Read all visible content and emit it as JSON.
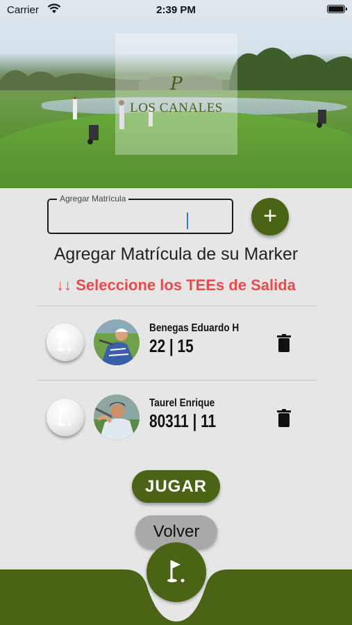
{
  "status_bar": {
    "carrier": "Carrier",
    "time": "2:39 PM"
  },
  "hero": {
    "club_monogram": "P",
    "club_name": "LOS CANALES"
  },
  "matricula_input": {
    "label": "Agregar Matrícula",
    "value": ""
  },
  "add_button": {
    "icon": "plus-icon"
  },
  "marker_title": "Agregar Matrícula de su Marker",
  "tees_warning": "↓↓ Seleccione los TEEs de Salida",
  "players": [
    {
      "name": "Benegas Eduardo H",
      "stats": "22 | 15",
      "tee_icon": "golf-flag-icon",
      "delete_icon": "trash-icon"
    },
    {
      "name": "Taurel Enrique",
      "stats": "80311 | 11",
      "tee_icon": "golf-flag-icon",
      "delete_icon": "trash-icon"
    }
  ],
  "jugar_button": "JUGAR",
  "volver_button": "Volver",
  "bottom_nav": {
    "icon": "golf-flag-icon"
  },
  "colors": {
    "primary": "#4b6314",
    "warning": "#ec4a4a",
    "background": "#e6e6e6",
    "secondary_button": "#a9a9a9"
  }
}
